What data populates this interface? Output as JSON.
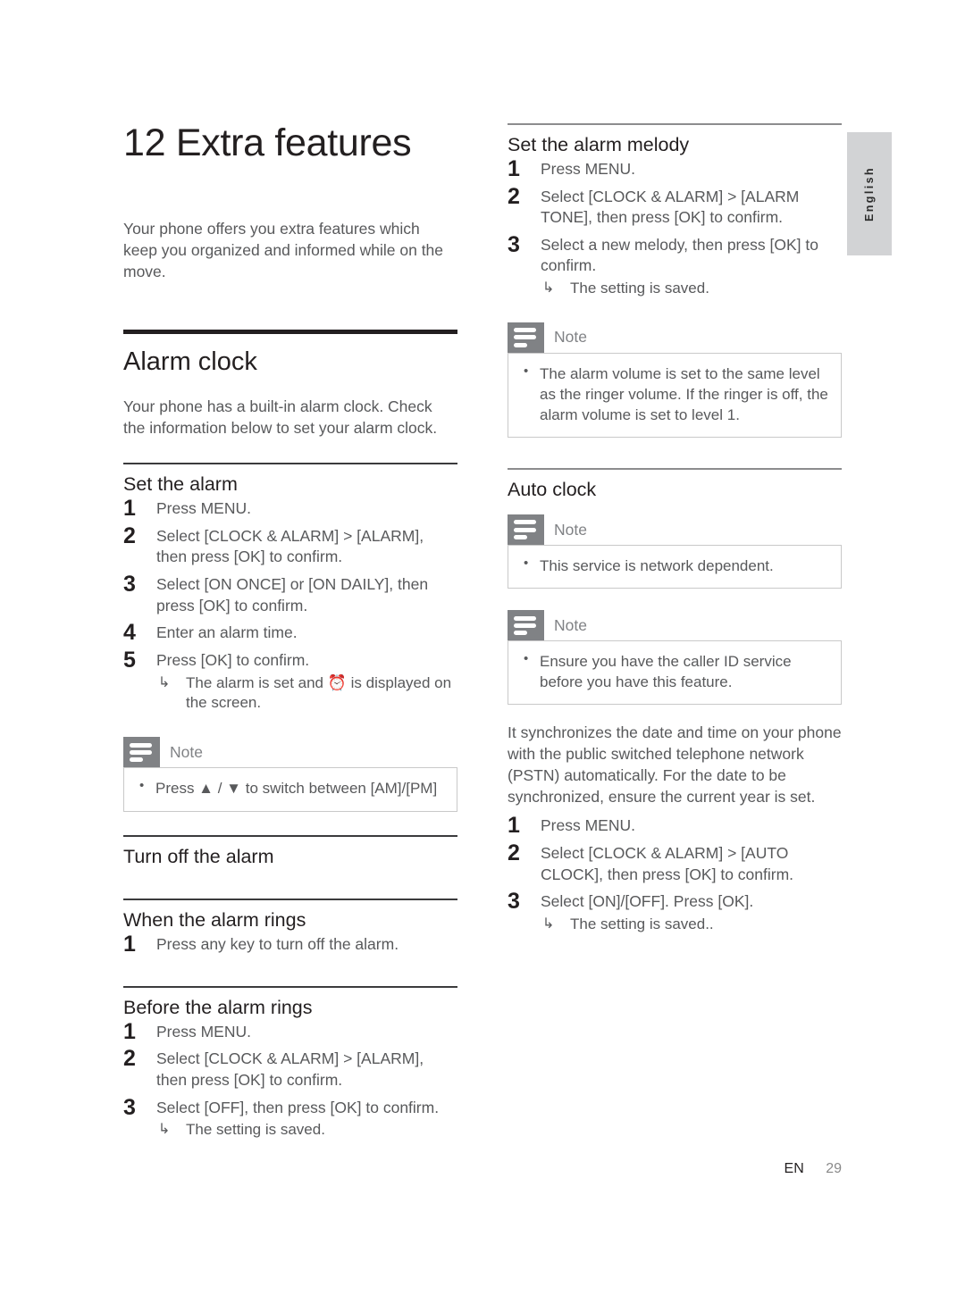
{
  "page": {
    "footer": {
      "language_code": "EN",
      "page_number": "29"
    },
    "side_tab": {
      "label": "English"
    }
  },
  "chapter": {
    "number": "12",
    "title": "Extra features",
    "intro": "Your phone offers you extra features which keep you organized and informed while on the move."
  },
  "left_column": {
    "section": {
      "heading": "Alarm clock",
      "intro": "Your phone has a built-in alarm clock. Check the information below to set your alarm clock."
    },
    "set_the_alarm": {
      "heading": "Set the alarm",
      "steps": [
        {
          "n": "1",
          "text": "Press MENU."
        },
        {
          "n": "2",
          "text": "Select [CLOCK & ALARM] > [ALARM], then press [OK] to confirm."
        },
        {
          "n": "3",
          "text": "Select [ON ONCE] or [ON DAILY], then press [OK] to confirm."
        },
        {
          "n": "4",
          "text": "Enter an alarm time."
        },
        {
          "n": "5",
          "text": "Press [OK] to confirm.",
          "sub": "The alarm is set and ⏰ is displayed on the screen."
        }
      ]
    },
    "note_ampm": {
      "label": "Note",
      "items": [
        "Press ▲ / ▼ to switch between [AM]/[PM]"
      ]
    },
    "turn_off_the_alarm": {
      "heading": "Turn off the alarm"
    },
    "when_the_alarm_rings": {
      "heading": "When the alarm rings",
      "steps": [
        {
          "n": "1",
          "text": "Press any key to turn off the alarm."
        }
      ]
    },
    "before_the_alarm_rings": {
      "heading": "Before the alarm rings",
      "steps": [
        {
          "n": "1",
          "text": "Press MENU."
        },
        {
          "n": "2",
          "text": "Select [CLOCK & ALARM] > [ALARM], then press [OK] to confirm."
        },
        {
          "n": "3",
          "text": "Select [OFF], then press [OK] to confirm.",
          "sub": "The setting is saved."
        }
      ]
    }
  },
  "right_column": {
    "set_the_alarm_melody": {
      "heading": "Set the alarm melody",
      "steps": [
        {
          "n": "1",
          "text": "Press MENU."
        },
        {
          "n": "2",
          "text": "Select [CLOCK & ALARM] > [ALARM TONE], then press [OK] to confirm."
        },
        {
          "n": "3",
          "text": "Select a new melody, then press [OK] to confirm.",
          "sub": "The setting is saved."
        }
      ]
    },
    "note_volume": {
      "label": "Note",
      "items": [
        "The alarm volume is set to the same level as the ringer volume. If the ringer is off, the alarm volume is set to level 1."
      ]
    },
    "auto_clock": {
      "heading": "Auto clock",
      "note_network": {
        "label": "Note",
        "items": [
          "This service is network dependent."
        ]
      },
      "note_callerid": {
        "label": "Note",
        "items": [
          "Ensure you have the caller ID service before you have this feature."
        ]
      },
      "paragraph": "It synchronizes the date and time on your phone with the public switched telephone network (PSTN) automatically. For the date to be synchronized, ensure the current year is set.",
      "steps": [
        {
          "n": "1",
          "text": "Press MENU."
        },
        {
          "n": "2",
          "text": "Select [CLOCK & ALARM] > [AUTO CLOCK], then press [OK] to confirm."
        },
        {
          "n": "3",
          "text": "Select [ON]/[OFF]. Press [OK].",
          "sub": "The setting is saved.."
        }
      ]
    }
  },
  "colors": {
    "heading_dark": "#231f20",
    "body_gray": "#58595b",
    "note_tab_gray": "#808285",
    "note_border": "#c9c9c9",
    "side_tab_bg": "#d2d3d5"
  }
}
